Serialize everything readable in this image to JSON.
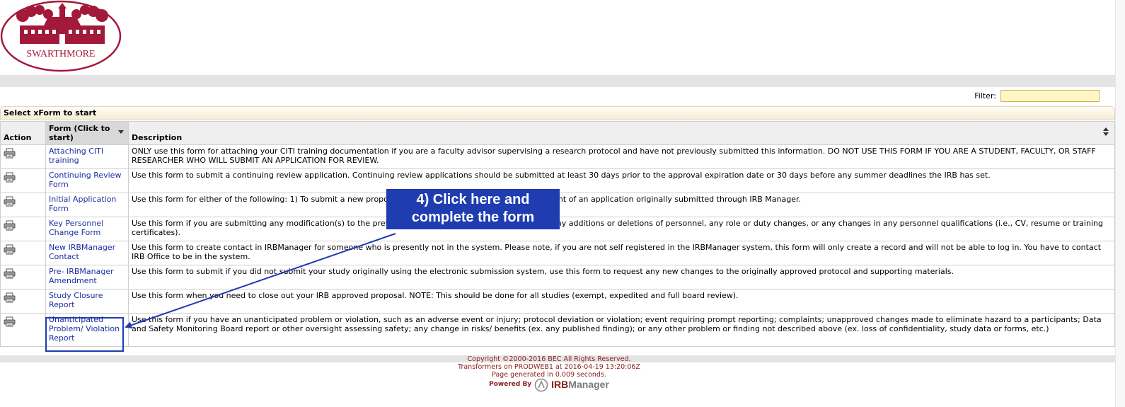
{
  "logo": {
    "text": "SWARTHMORE",
    "color": "#a3193a"
  },
  "filter": {
    "label": "Filter:",
    "value": ""
  },
  "section": {
    "title": "Select xForm to start"
  },
  "table": {
    "headers": {
      "action": "Action",
      "form": "Form (Click to start)",
      "description": "Description"
    },
    "rows": [
      {
        "form": "Attaching CITI training",
        "description": "ONLY use this form for attaching your CITI training documentation if you are a faculty advisor supervising a research protocol and have not previously submitted this information. DO NOT USE THIS FORM IF YOU ARE A STUDENT, FACULTY, OR STAFF RESEARCHER WHO WILL SUBMIT AN APPLICATION FOR REVIEW."
      },
      {
        "form": "Continuing Review Form",
        "description": "Use this form to submit a continuing review application. Continuing review applications should be submitted at least 30 days prior to the approval expiration date or 30 days before any summer deadlines the IRB has set."
      },
      {
        "form": "Initial Application Form",
        "description": "Use this form for either of the following: 1) To submit a new proposal for review; or 2) To submit an amendment of an application originally submitted through IRB Manager."
      },
      {
        "form": "Key Personnel Change Form",
        "description": "Use this form if you are submitting any modification(s) to the previously approved key personnel, including any additions or deletions of personnel, any role or duty changes, or any changes in any personnel qualifications (i.e., CV, resume or training certificates)."
      },
      {
        "form": "New IRBManager Contact",
        "description": "Use this form to create contact in IRBManager for someone who is presently not in the system. Please note, if you are not self registered in the IRBManager system, this form will only create a record and will not be able to log in. You have to contact IRB Office to be in the system."
      },
      {
        "form": "Pre- IRBManager Amendment",
        "description": "Use this form to submit if you did not submit your study originally using the electronic submission system, use this form to request any new changes to the originally approved protocol and supporting materials."
      },
      {
        "form": "Study Closure Report",
        "description": "Use this form when you need to close out your IRB approved proposal. NOTE: This should be done for all studies (exempt, expedited and full board review)."
      },
      {
        "form": "Unanticipated Problem/ Violation Report",
        "description": "Use this form if you have an unanticipated problem or violation, such as an adverse event or injury; protocol deviation or violation; event requiring prompt reporting; complaints; unapproved changes made to eliminate hazard to a participants; Data and Safety Monitoring Board report or other oversight assessing safety; any change in risks/ benefits (ex. any published finding); or any other problem or finding not described above (ex. loss of confidentiality, study data or forms, etc.)"
      }
    ]
  },
  "callout": {
    "line1": "4) Click here and",
    "line2": "complete the form",
    "color": "#1f3db0"
  },
  "footer": {
    "copyright": "Copyright ©2000-2016 BEC All Rights Reserved.",
    "server": "Transformers on PRODWEB1 at 2016-04-19 13:20:06Z",
    "generated": "Page generated in 0.009 seconds.",
    "powered_by": "Powered By",
    "brand_irb": "IRB",
    "brand_manager": "Manager"
  },
  "icons": {
    "print": "printer-icon"
  }
}
